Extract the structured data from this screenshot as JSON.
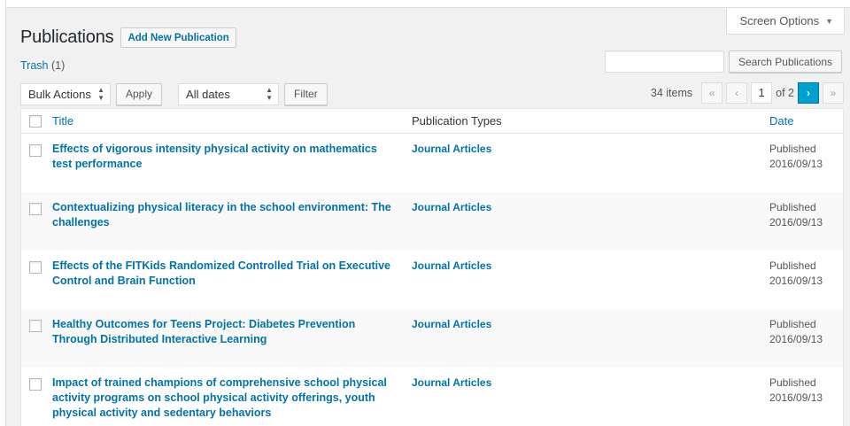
{
  "screen_options": {
    "label": "Screen Options"
  },
  "header": {
    "title": "Publications",
    "add_new_label": "Add New Publication"
  },
  "views": {
    "trash_label": "Trash",
    "trash_count": "(1)"
  },
  "search": {
    "button_label": "Search Publications",
    "value": ""
  },
  "tablenav": {
    "bulk_actions": "Bulk Actions",
    "apply_label": "Apply",
    "dates_filter": "All dates",
    "filter_label": "Filter",
    "items_count": "34 items",
    "current_page": "1",
    "of_pages": "of 2",
    "first_glyph": "«",
    "prev_glyph": "‹",
    "next_glyph": "›",
    "last_glyph": "»"
  },
  "columns": {
    "title": "Title",
    "types": "Publication Types",
    "date": "Date"
  },
  "rows": [
    {
      "title": "Effects of vigorous intensity physical activity on mathematics test performance",
      "type": "Journal Articles",
      "status": "Published",
      "date": "2016/09/13"
    },
    {
      "title": "Contextualizing physical literacy in the school environment: The challenges",
      "type": "Journal Articles",
      "status": "Published",
      "date": "2016/09/13"
    },
    {
      "title": "Effects of the FITKids Randomized Controlled Trial on Executive Control and Brain Function",
      "type": "Journal Articles",
      "status": "Published",
      "date": "2016/09/13"
    },
    {
      "title": "Healthy Outcomes for Teens Project: Diabetes Prevention Through Distributed Interactive Learning",
      "type": "Journal Articles",
      "status": "Published",
      "date": "2016/09/13"
    },
    {
      "title": "Impact of trained champions of comprehensive school physical activity programs on school physical activity offerings, youth physical activity and sedentary behaviors",
      "type": "Journal Articles",
      "status": "Published",
      "date": "2016/09/13"
    }
  ],
  "colors": {
    "link": "#0073aa",
    "accent": "#00a0d2",
    "background": "#f1f1f1"
  }
}
